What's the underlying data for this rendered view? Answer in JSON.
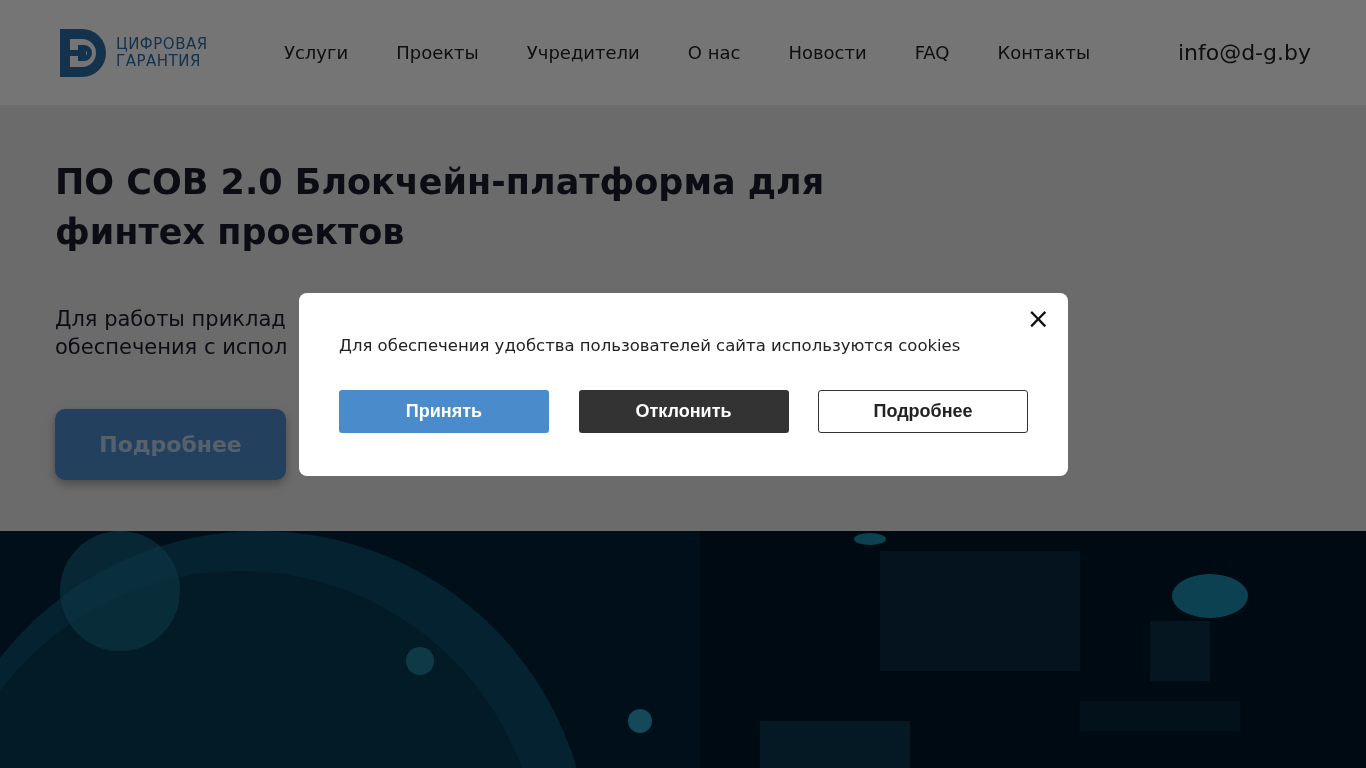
{
  "header": {
    "logo_text": [
      "ЦИФРОВАЯ",
      "ГАРАНТИЯ"
    ],
    "nav": [
      "Услуги",
      "Проекты",
      "Учредители",
      "О нас",
      "Новости",
      "FAQ",
      "Контакты"
    ],
    "email": "info@d-g.by"
  },
  "hero": {
    "title": "ПО СОВ 2.0 Блокчейн-платформа для финтех проектов",
    "text_lines": [
      "Для работы приклад",
      "обеспечения с испол"
    ],
    "button": "Подробнее"
  },
  "cookie_dialog": {
    "message": "Для обеспечения удобства пользователей сайта используются cookies",
    "close": "×",
    "buttons": [
      {
        "label": "Принять",
        "kind": "primary"
      },
      {
        "label": "Отклонить",
        "kind": "dark"
      },
      {
        "label": "Подробнее",
        "kind": "outline"
      }
    ]
  }
}
